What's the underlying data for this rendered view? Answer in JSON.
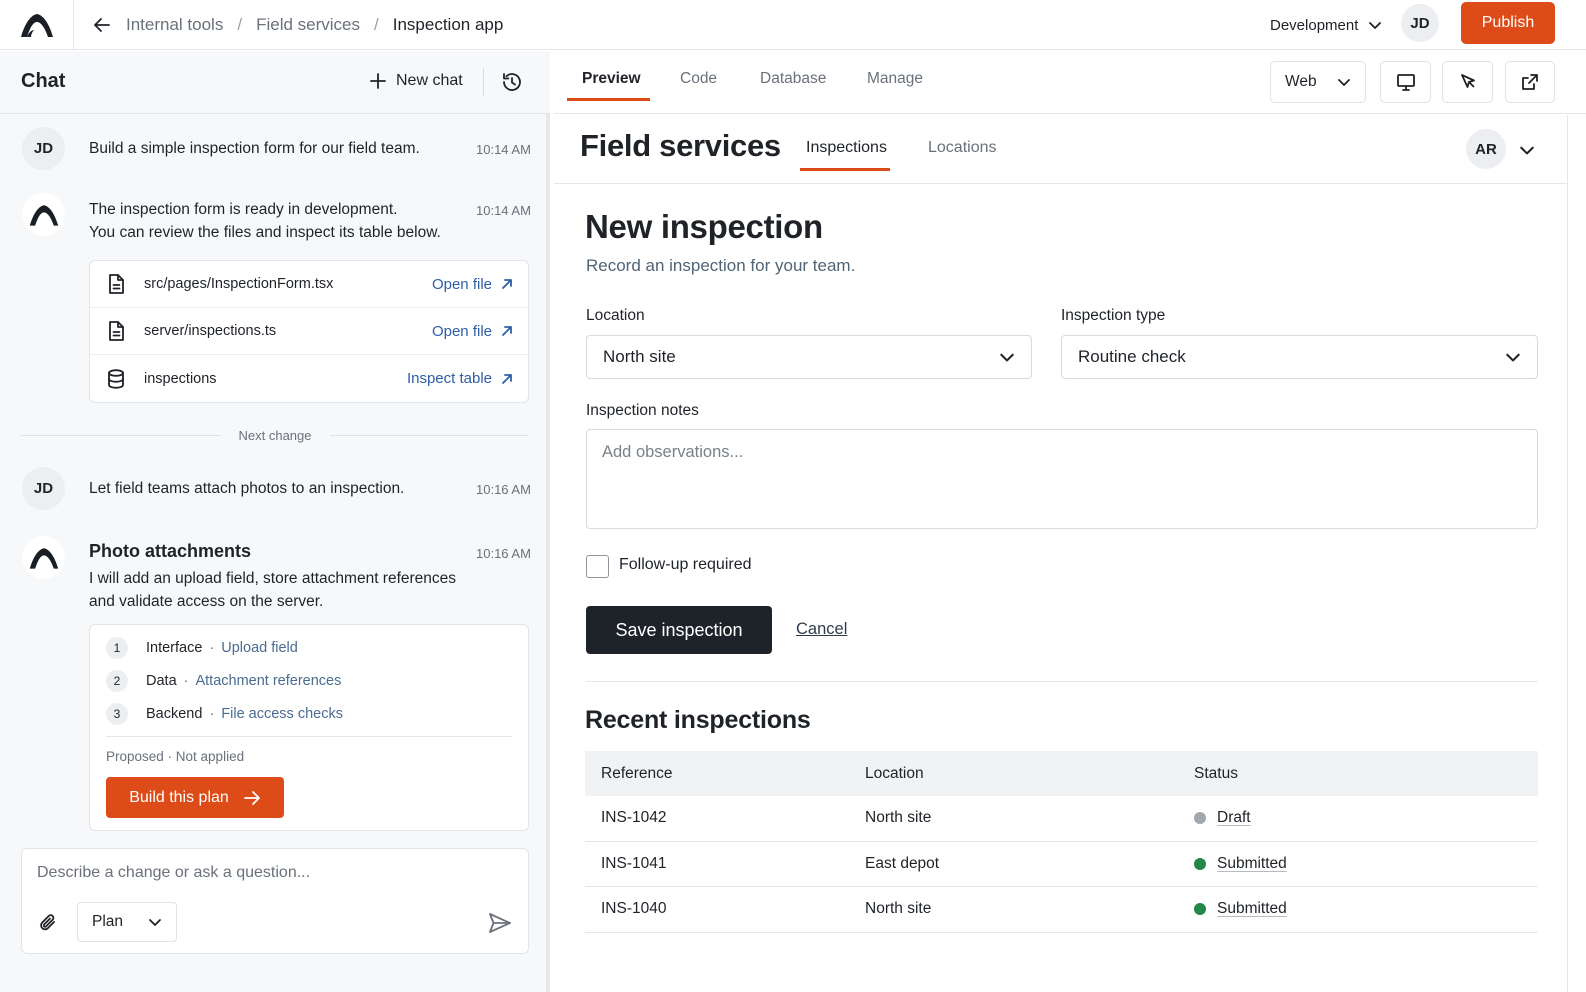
{
  "topbar": {
    "breadcrumbs": [
      "Internal tools",
      "Field services",
      "Inspection app"
    ],
    "environment": "Development",
    "user_initials": "JD",
    "publish_label": "Publish"
  },
  "chat": {
    "title": "Chat",
    "new_chat_label": "New chat",
    "messages": [
      {
        "initials": "JD",
        "text": "Build a simple inspection form for our field team.",
        "time": "10:14 AM"
      },
      {
        "line1": "The inspection form is ready in development.",
        "line2": "You can review the files and inspect its table below.",
        "time": "10:14 AM"
      },
      {
        "initials": "JD",
        "text": "Let field teams attach photos to an inspection.",
        "time": "10:16 AM"
      },
      {
        "title": "Photo attachments",
        "line1": "I will add an upload field, store attachment references",
        "line2": "and validate access on the server.",
        "time": "10:16 AM"
      }
    ],
    "files": [
      {
        "name": "src/pages/InspectionForm.tsx",
        "action": "Open file",
        "icon": "file-icon"
      },
      {
        "name": "server/inspections.ts",
        "action": "Open file",
        "icon": "file-icon"
      },
      {
        "name": "inspections",
        "action": "Inspect table",
        "icon": "database-icon"
      }
    ],
    "divider_label": "Next change",
    "plan_steps": [
      {
        "num": "1",
        "label": "Interface",
        "detail": "Upload field"
      },
      {
        "num": "2",
        "label": "Data",
        "detail": "Attachment references"
      },
      {
        "num": "3",
        "label": "Backend",
        "detail": "File access checks"
      }
    ],
    "plan_status": "Proposed · Not applied",
    "build_label": "Build this plan",
    "composer_placeholder": "Describe a change or ask a question...",
    "mode": "Plan"
  },
  "preview": {
    "tabs": [
      "Preview",
      "Code",
      "Database",
      "Manage"
    ],
    "device": "Web",
    "app_title": "Field services",
    "app_tabs": [
      "Inspections",
      "Locations"
    ],
    "app_user": "AR",
    "form": {
      "title": "New inspection",
      "subtitle": "Record an inspection for your team.",
      "location_label": "Location",
      "location_value": "North site",
      "type_label": "Inspection type",
      "type_value": "Routine check",
      "notes_label": "Inspection notes",
      "notes_placeholder": "Add observations...",
      "followup_label": "Follow-up required",
      "save_label": "Save inspection",
      "cancel_label": "Cancel"
    },
    "recent": {
      "title": "Recent inspections",
      "headers": [
        "Reference",
        "Location",
        "Status"
      ],
      "rows": [
        {
          "ref": "INS-1042",
          "location": "North site",
          "status": "Draft",
          "color": "#a3a8ae"
        },
        {
          "ref": "INS-1041",
          "location": "East depot",
          "status": "Submitted",
          "color": "#21884a"
        },
        {
          "ref": "INS-1040",
          "location": "North site",
          "status": "Submitted",
          "color": "#21884a"
        }
      ]
    }
  },
  "colors": {
    "accent": "#dd4b18",
    "dark_button": "#1e2329",
    "link": "#2e5ea8"
  }
}
